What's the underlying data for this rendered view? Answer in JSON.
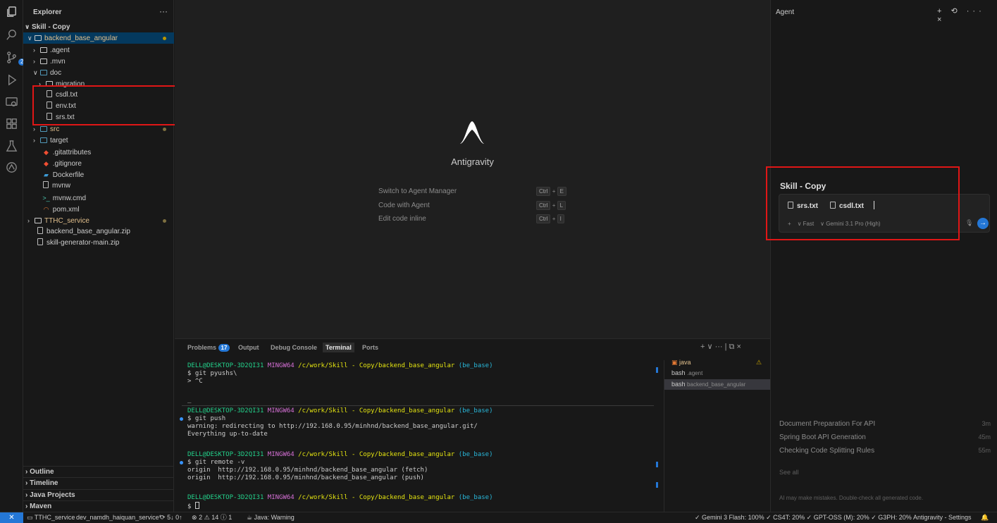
{
  "explorer": {
    "title": "Explorer",
    "more": "···",
    "root": "Skill - Copy",
    "items": [
      {
        "label": "backend_base_angular",
        "type": "folder-open"
      },
      {
        "label": ".agent",
        "type": "folder"
      },
      {
        "label": ".mvn",
        "type": "folder"
      },
      {
        "label": "doc",
        "type": "folder-open"
      },
      {
        "label": "migration",
        "type": "folder"
      },
      {
        "label": "csdl.txt",
        "type": "file"
      },
      {
        "label": "env.txt",
        "type": "file"
      },
      {
        "label": "srs.txt",
        "type": "file"
      },
      {
        "label": "src",
        "type": "folder"
      },
      {
        "label": "target",
        "type": "folder"
      },
      {
        "label": ".gitattributes",
        "type": "git"
      },
      {
        "label": ".gitignore",
        "type": "git"
      },
      {
        "label": "Dockerfile",
        "type": "docker"
      },
      {
        "label": "mvnw",
        "type": "file"
      },
      {
        "label": "mvnw.cmd",
        "type": "terminal"
      },
      {
        "label": "pom.xml",
        "type": "rss"
      },
      {
        "label": "TTHC_service",
        "type": "folder"
      },
      {
        "label": "backend_base_angular.zip",
        "type": "file"
      },
      {
        "label": "skill-generator-main.zip",
        "type": "file"
      }
    ],
    "sections": [
      "Outline",
      "Timeline",
      "Java Projects",
      "Maven"
    ]
  },
  "editor": {
    "app_name": "Antigravity",
    "shortcuts": [
      {
        "label": "Switch to Agent Manager",
        "key": "E"
      },
      {
        "label": "Code with Agent",
        "key": "L"
      },
      {
        "label": "Edit code inline",
        "key": "I"
      }
    ],
    "ctrl": "Ctrl",
    "plus": "+"
  },
  "panel": {
    "tabs": {
      "problems": "Problems",
      "problems_count": "17",
      "output": "Output",
      "debug": "Debug Console",
      "terminal": "Terminal",
      "ports": "Ports"
    },
    "tools": "+ ∨ ··· | ⧉ ×",
    "terminal": {
      "user": "DELL@DESKTOP-3D2QI31",
      "shell": "MINGW64",
      "path": "/c/work/Skill - Copy/backend_base_angular",
      "branch": "(be_base)",
      "lines1": [
        "$ git pyushs\\",
        "> ^C"
      ],
      "cursor_line": "_",
      "lines2": [
        "$ git push",
        "warning: redirecting to http://192.168.0.95/minhnd/backend_base_angular.git/",
        "Everything up-to-date"
      ],
      "lines3": [
        "$ git remote -v",
        "origin  http://192.168.0.95/minhnd/backend_base_angular (fetch)",
        "origin  http://192.168.0.95/minhnd/backend_base_angular (push)"
      ],
      "prompt": "$"
    },
    "terminals": [
      {
        "name": "java",
        "sub": ""
      },
      {
        "name": "bash",
        "sub": ".agent"
      },
      {
        "name": "bash",
        "sub": "backend_base_angular"
      }
    ]
  },
  "agent": {
    "title": "Agent",
    "tools": "+ ⟲ ··· ×",
    "workspace": "Skill - Copy",
    "chips": [
      "srs.txt",
      "csdl.txt"
    ],
    "mode": "Fast",
    "model": "Gemini 3.1 Pro (High)",
    "history": [
      {
        "title": "Document Preparation For API",
        "time": "3m"
      },
      {
        "title": "Spring Boot API Generation",
        "time": "45m"
      },
      {
        "title": "Checking Code Splitting Rules",
        "time": "55m"
      }
    ],
    "see_all": "See all",
    "disclaimer": "AI may make mistakes. Double-check all generated code."
  },
  "status": {
    "project": "TTHC_service",
    "branch": "dev_namdh_haiquan_service*",
    "sync": "5↓ 0↑",
    "errors": "2",
    "warnings": "14",
    "info": "1",
    "java": "Java: Warning",
    "right": "✓ Gemini 3 Flash: 100%  ✓ CS4T: 20%  ✓ GPT-OSS (M): 20%  ✓ G3PH: 20%",
    "settings": "Antigravity - Settings"
  }
}
